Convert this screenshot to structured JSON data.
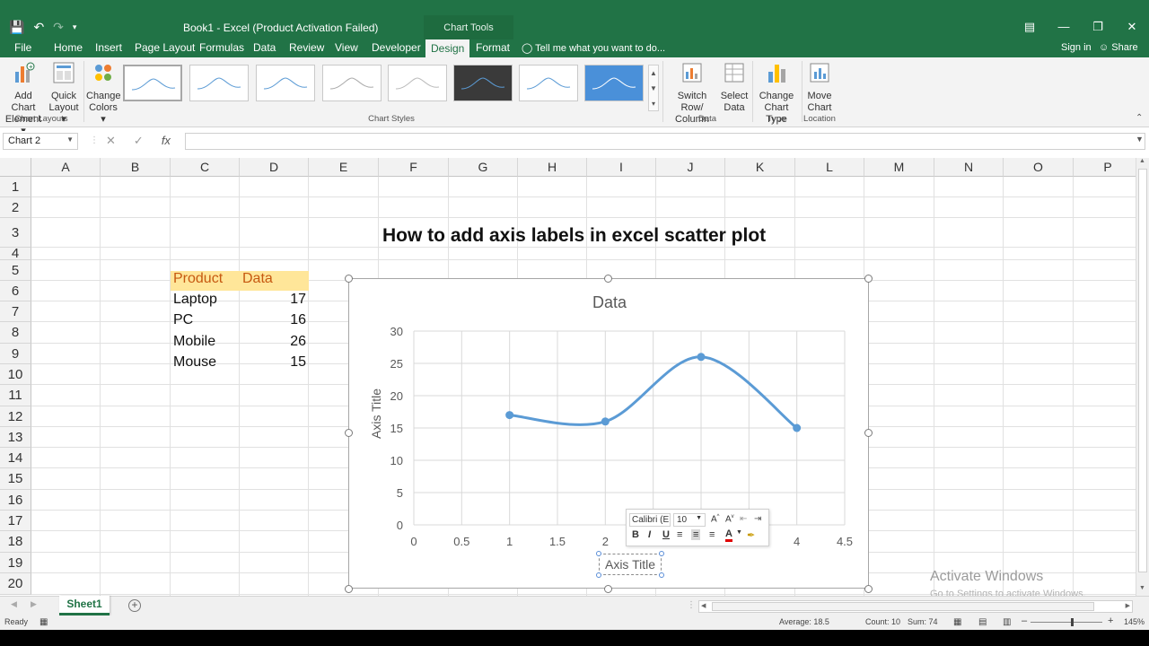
{
  "window": {
    "title": "Book1 - Excel (Product Activation Failed)",
    "chart_tools": "Chart Tools"
  },
  "tabs": [
    "File",
    "Home",
    "Insert",
    "Page Layout",
    "Formulas",
    "Data",
    "Review",
    "View",
    "Developer",
    "Design",
    "Format"
  ],
  "active_tab": "Design",
  "tell_me": "Tell me what you want to do...",
  "sign_in": "Sign in",
  "share": "Share",
  "ribbon": {
    "add_chart_element": [
      "Add Chart",
      "Element"
    ],
    "quick_layout": [
      "Quick",
      "Layout"
    ],
    "change_colors": [
      "Change",
      "Colors"
    ],
    "group_chart_layouts": "Chart Layouts",
    "group_chart_styles": "Chart Styles",
    "switch_row_column": [
      "Switch Row/",
      "Column"
    ],
    "select_data": [
      "Select",
      "Data"
    ],
    "group_data": "Data",
    "change_chart_type": [
      "Change",
      "Chart Type"
    ],
    "group_type": "Type",
    "move_chart": [
      "Move",
      "Chart"
    ],
    "group_location": "Location"
  },
  "formula_bar": {
    "name_box": "Chart 2",
    "fx": "fx",
    "value": ""
  },
  "columns": [
    "A",
    "B",
    "C",
    "D",
    "E",
    "F",
    "G",
    "H",
    "I",
    "J",
    "K",
    "L",
    "M",
    "N",
    "O",
    "P"
  ],
  "rows": [
    "1",
    "2",
    "3",
    "4",
    "5",
    "6",
    "7",
    "8",
    "9",
    "10",
    "11",
    "12",
    "13",
    "14",
    "15",
    "16",
    "17",
    "18",
    "19",
    "20"
  ],
  "sheet_title": "How to add axis labels in excel scatter plot",
  "table": {
    "headers": [
      "Product",
      "Data"
    ],
    "rows": [
      [
        "Laptop",
        "17"
      ],
      [
        "PC",
        "16"
      ],
      [
        "Mobile",
        "26"
      ],
      [
        "Mouse",
        "15"
      ]
    ]
  },
  "chart_data": {
    "type": "scatter",
    "title": "Data",
    "xlabel": "Axis Title",
    "ylabel": "Axis Title",
    "x": [
      1,
      2,
      3,
      4
    ],
    "y": [
      17,
      16,
      26,
      15
    ],
    "xlim": [
      0,
      4.5
    ],
    "ylim": [
      0,
      30
    ],
    "x_ticks": [
      "0",
      "0.5",
      "1",
      "1.5",
      "2",
      "2.5",
      "3",
      "3.5",
      "4",
      "4.5"
    ],
    "y_ticks": [
      "0",
      "5",
      "10",
      "15",
      "20",
      "25",
      "30"
    ],
    "smooth": true,
    "grid": true,
    "series_color": "#5b9bd5"
  },
  "mini_toolbar": {
    "font": "Calibri (E",
    "size": "10",
    "bold": "B",
    "italic": "I",
    "underline": "U",
    "font_color_label": "A"
  },
  "watermark": {
    "line1": "Activate Windows",
    "line2": "Go to Settings to activate Windows."
  },
  "sheet_tab": "Sheet1",
  "status": {
    "ready": "Ready",
    "average": "Average: 18.5",
    "count": "Count: 10",
    "sum": "Sum: 74",
    "zoom": "145%"
  },
  "colors": {
    "excel_green": "#217346",
    "header_fill": "#ffe699",
    "header_text": "#c65911"
  }
}
